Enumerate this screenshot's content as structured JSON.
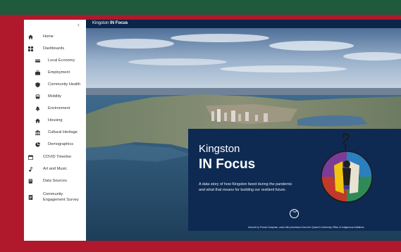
{
  "header": {
    "title_plain": "Kingston",
    "title_bold": "IN Focus"
  },
  "sidebar": {
    "items": [
      {
        "label": "Home",
        "icon": "home-icon"
      },
      {
        "label": "Dashboards",
        "icon": "dashboard-icon"
      },
      {
        "label": "Local Economy",
        "icon": "economy-icon"
      },
      {
        "label": "Employment",
        "icon": "briefcase-icon"
      },
      {
        "label": "Community Health",
        "icon": "health-icon"
      },
      {
        "label": "Mobility",
        "icon": "bus-icon"
      },
      {
        "label": "Environment",
        "icon": "tree-icon"
      },
      {
        "label": "Housing",
        "icon": "house-icon"
      },
      {
        "label": "Cultural Heritage",
        "icon": "landmark-icon"
      },
      {
        "label": "Demographics",
        "icon": "pie-chart-icon"
      },
      {
        "label": "COVID Timeline",
        "icon": "calendar-icon"
      },
      {
        "label": "Art and Music",
        "icon": "music-icon"
      },
      {
        "label": "Data Sources",
        "icon": "database-icon"
      },
      {
        "label": "Community",
        "label2": "Engagement Survey",
        "icon": "survey-icon"
      }
    ]
  },
  "hero": {
    "title_line1": "Kingston",
    "title_line2": "IN Focus",
    "description": "A data story of how Kingston fared during the pandemic and what that means for building our resilient future.",
    "credit": "Artwork by Porsia Chapman, used with permission from the Queen's University Office of Indigenous Initiatives"
  },
  "colors": {
    "page_border": "#b0182c",
    "top_bar": "#1e5a3b",
    "navy": "#0c2447",
    "card": "#0e2a52"
  }
}
